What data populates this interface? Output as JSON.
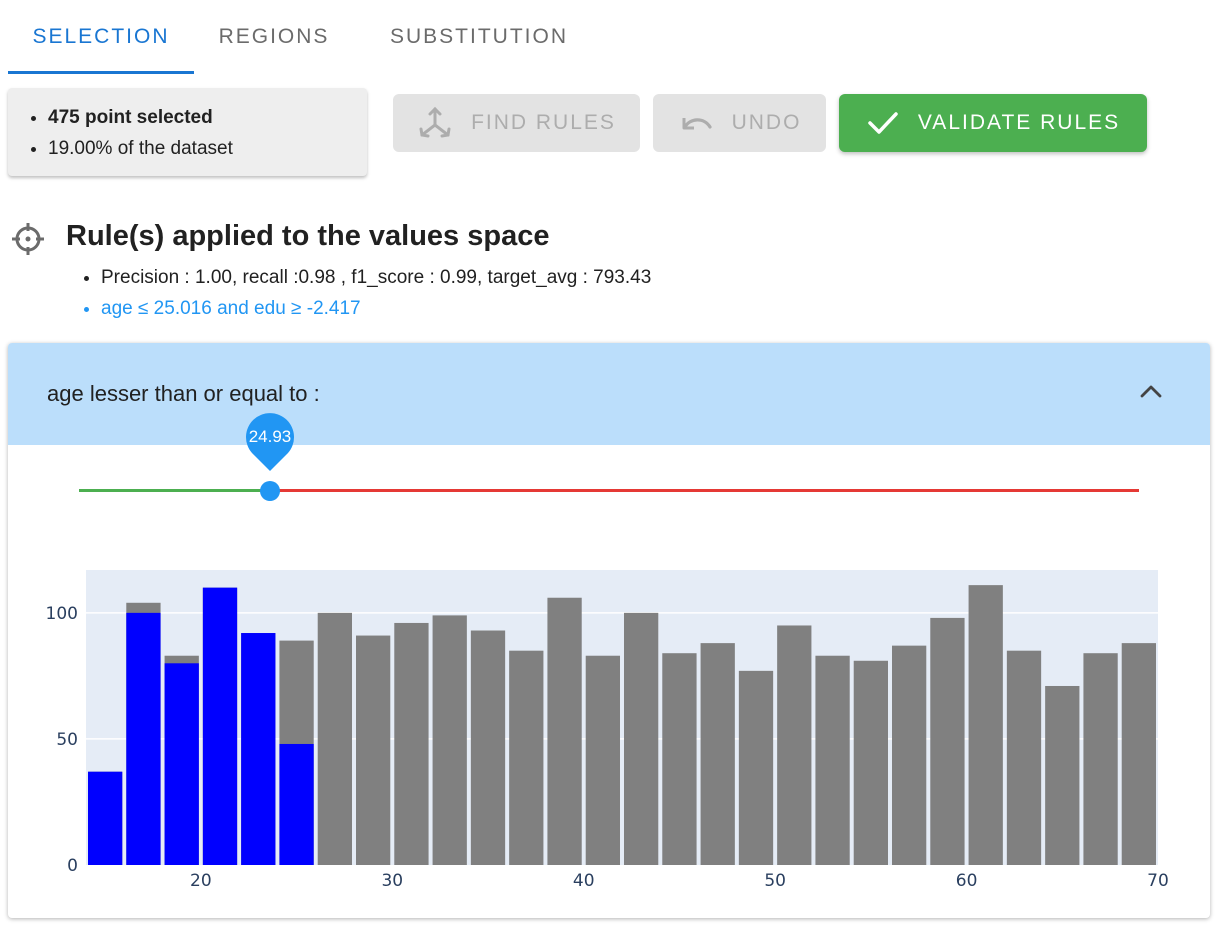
{
  "tabs": [
    {
      "label": "SELECTION",
      "active": true
    },
    {
      "label": "REGIONS",
      "active": false
    },
    {
      "label": "SUBSTITUTION",
      "active": false
    }
  ],
  "selection_info": {
    "points": "475 point selected",
    "percent": "19.00% of the dataset"
  },
  "buttons": {
    "find_rules": "FIND RULES",
    "undo": "UNDO",
    "validate_rules": "VALIDATE RULES"
  },
  "rules": {
    "title": "Rule(s) applied to the values space",
    "metrics": "Precision : 1.00, recall :0.98 , f1_score : 0.99, target_avg : 793.43",
    "expression": "age ≤ 25.016 and edu ≥ -2.417"
  },
  "panel": {
    "label": "age lesser than or equal to :",
    "slider_value": "24.93",
    "slider_fraction": 0.18
  },
  "colors": {
    "accent": "#1976d2",
    "validate": "#4caf50",
    "selected_bar": "#0000ff",
    "unselected_bar": "#808080",
    "plot_bg": "#e5ecf6",
    "slider_in": "#4caf50",
    "slider_out": "#e53935"
  },
  "chart_data": {
    "type": "bar",
    "barmode": "overlay",
    "x_start": 15,
    "bin_width": 2,
    "xlim": [
      14,
      70
    ],
    "ylim": [
      0,
      117
    ],
    "xticks": [
      20,
      30,
      40,
      50,
      60,
      70
    ],
    "yticks": [
      0,
      50,
      100
    ],
    "grid": true,
    "series": [
      {
        "values": [
          37,
          104,
          83,
          110,
          92,
          89,
          100,
          91,
          96,
          99,
          93,
          85,
          106,
          83,
          100,
          84,
          88,
          77,
          95,
          83,
          81,
          87,
          98,
          111,
          85,
          71,
          84,
          88
        ]
      },
      {
        "values": [
          37,
          100,
          80,
          110,
          92,
          48
        ]
      }
    ]
  }
}
